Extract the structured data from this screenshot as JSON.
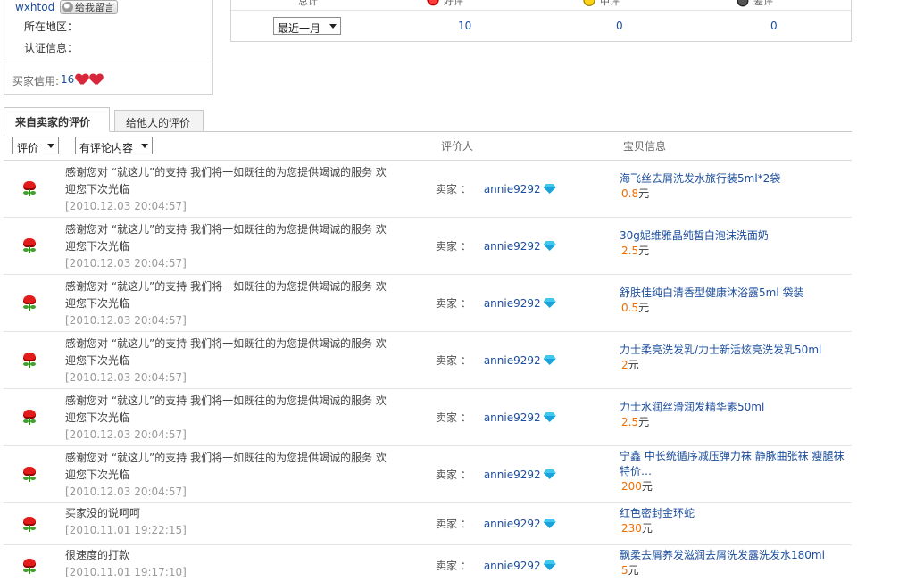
{
  "profile": {
    "username": "wxhtod",
    "message_button": "给我留言",
    "region_label": "所在地区：",
    "verify_label": "认证信息：",
    "credit_label": "买家信用:",
    "credit_value": "16"
  },
  "summary": {
    "total_label": "总计",
    "good_label": "好评",
    "neutral_label": "中评",
    "bad_label": "差评",
    "period_select": "最近一月",
    "good_count": "10",
    "neutral_count": "0",
    "bad_count": "0"
  },
  "tabs": {
    "from_seller": "来自卖家的评价",
    "to_others": "给他人的评价"
  },
  "table": {
    "rating_filter": "评价",
    "content_filter": "有评论内容",
    "rater_header": "评价人",
    "item_header": "宝贝信息",
    "seller_role": "卖家 ："
  },
  "rows": [
    {
      "comment": "感谢您对 “就这儿”的支持 我们将一如既往的为您提供竭诚的服务 欢迎您下次光临",
      "time": "[2010.12.03 20:04:57]",
      "rater": "annie9292",
      "item": "海飞丝去屑洗发水旅行装5ml*2袋",
      "price": "0.8",
      "unit": "元"
    },
    {
      "comment": "感谢您对 “就这儿”的支持 我们将一如既往的为您提供竭诚的服务 欢迎您下次光临",
      "time": "[2010.12.03 20:04:57]",
      "rater": "annie9292",
      "item": "30g妮维雅晶纯皙白泡沫洗面奶",
      "price": "2.5",
      "unit": "元"
    },
    {
      "comment": "感谢您对 “就这儿”的支持 我们将一如既往的为您提供竭诚的服务 欢迎您下次光临",
      "time": "[2010.12.03 20:04:57]",
      "rater": "annie9292",
      "item": "舒肤佳纯白清香型健康沐浴露5ml 袋装",
      "price": "0.5",
      "unit": "元"
    },
    {
      "comment": "感谢您对 “就这儿”的支持 我们将一如既往的为您提供竭诚的服务 欢迎您下次光临",
      "time": "[2010.12.03 20:04:57]",
      "rater": "annie9292",
      "item": "力士柔亮洗发乳/力士新活炫亮洗发乳50ml",
      "price": "2",
      "unit": "元"
    },
    {
      "comment": "感谢您对 “就这儿”的支持 我们将一如既往的为您提供竭诚的服务 欢迎您下次光临",
      "time": "[2010.12.03 20:04:57]",
      "rater": "annie9292",
      "item": "力士水润丝滑润发精华素50ml",
      "price": "2.5",
      "unit": "元"
    },
    {
      "comment": "感谢您对 “就这儿”的支持 我们将一如既往的为您提供竭诚的服务 欢迎您下次光临",
      "time": "[2010.12.03 20:04:57]",
      "rater": "annie9292",
      "item": "宁鑫 中长统循序减压弹力袜 静脉曲张袜 瘦腿袜 特价…",
      "price": "200",
      "unit": "元"
    },
    {
      "comment": "买家没的说呵呵",
      "time": "[2010.11.01 19:22:15]",
      "rater": "annie9292",
      "item": "红色密封金环蛇",
      "price": "230",
      "unit": "元"
    },
    {
      "comment": "很速度的打款",
      "time": "[2010.11.01 19:17:10]",
      "rater": "annie9292",
      "item": "飘柔去屑养发滋润去屑洗发露洗发水180ml",
      "price": "5",
      "unit": "元"
    }
  ]
}
